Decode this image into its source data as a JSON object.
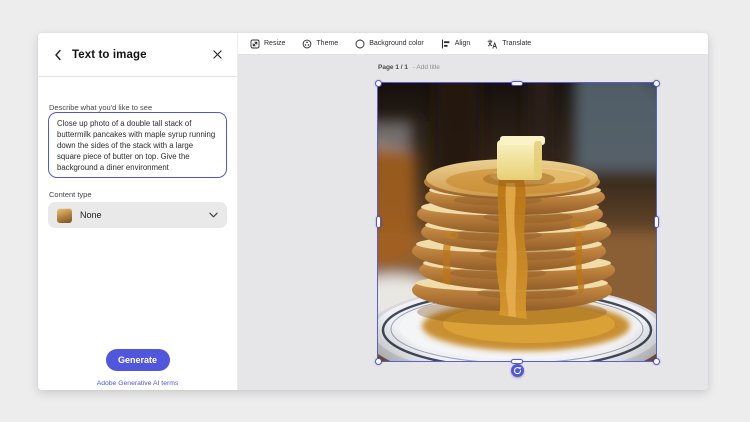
{
  "panel": {
    "title": "Text to image",
    "prompt_label": "Describe what you'd like to see",
    "prompt_value": "Close up photo of a double tall stack of buttermilk pancakes with maple syrup running down the sides of the stack with a large square piece of butter on top. Give the background a diner environment",
    "content_type_label": "Content type",
    "content_type_value": "None",
    "generate_label": "Generate",
    "terms_link": "Adobe Generative AI terms"
  },
  "toolbar": {
    "items": [
      {
        "label": "Resize",
        "icon": "resize-icon"
      },
      {
        "label": "Theme",
        "icon": "theme-icon"
      },
      {
        "label": "Background color",
        "icon": "background-color-icon"
      },
      {
        "label": "Align",
        "icon": "align-icon"
      },
      {
        "label": "Translate",
        "icon": "translate-icon"
      }
    ]
  },
  "canvas": {
    "page_label": "Page 1 / 1",
    "page_title_hint": "- Add title",
    "image_description": "Close-up photo of a tall stack of buttermilk pancakes with maple syrup dripping down, a square pat of butter on top, served on a white plate in a diner setting"
  },
  "icons": {
    "back": "chevron-left",
    "close": "x",
    "dropdown_chevron": "chevron-down",
    "rotate": "rotate-arrow"
  },
  "colors": {
    "accent": "#5157dc",
    "selection_border": "#5b5fd6",
    "canvas_background": "#e6e6e8",
    "syrup_amber": "#c5841c"
  }
}
